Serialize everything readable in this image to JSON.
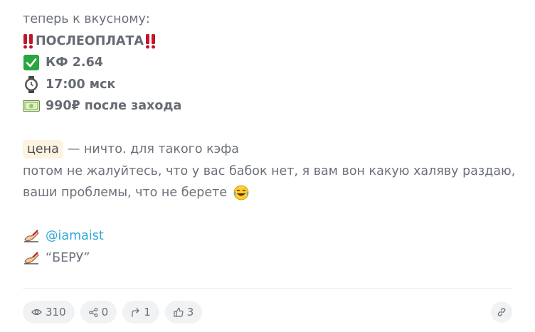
{
  "post": {
    "lines": {
      "intro": "теперь к вкусному:",
      "postpay": "ПОСЛЕОПЛАТА",
      "odds": "КФ 2.64",
      "time": "17:00 мск",
      "price": "990₽ после захода",
      "price_chip": "цена",
      "price_text": "— ничто. для такого кэфа",
      "complaint": "потом не жалуйтесь, что у вас бабок нет, я вам вон какую халяву раздаю,",
      "problems": "ваши проблемы, что не берете",
      "contact": "@iamaist",
      "keyword": "“БЕРУ”"
    },
    "icons": {
      "postpay": "double-exclamation-icon",
      "odds": "check-mark-button-icon",
      "time": "watch-icon",
      "price": "banknote-icon",
      "laugh": "tears-of-joy-icon",
      "write": "writing-hand-icon"
    },
    "colors": {
      "mention": "#2fa8d8",
      "exclamation": "#c0152a",
      "check": "#2aa63e",
      "chip_bg": "#fdf3e0"
    }
  },
  "stats": {
    "views": "310",
    "shares": "0",
    "forwards": "1",
    "likes": "3"
  }
}
